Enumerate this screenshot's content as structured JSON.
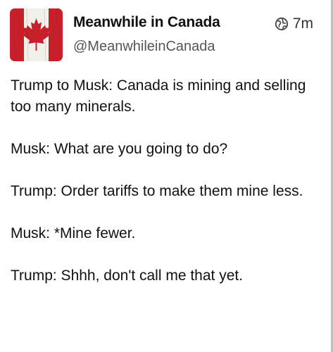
{
  "post": {
    "author": {
      "display_name": "Meanwhile in Canada",
      "handle": "@MeanwhileinCanada",
      "avatar_icon": "canadian-flag-avatar"
    },
    "visibility_icon": "globe-icon",
    "timestamp": "7m",
    "paragraphs": [
      "Trump to Musk: Canada is mining and selling too many minerals.",
      "Musk: What are you going to do?",
      "Trump: Order tariffs to make them mine less.",
      "Musk: *Mine fewer.",
      "Trump: Shhh, don't call me that yet."
    ]
  },
  "colors": {
    "flag_red": "#c8202a",
    "text": "#111111",
    "handle": "#555555"
  }
}
